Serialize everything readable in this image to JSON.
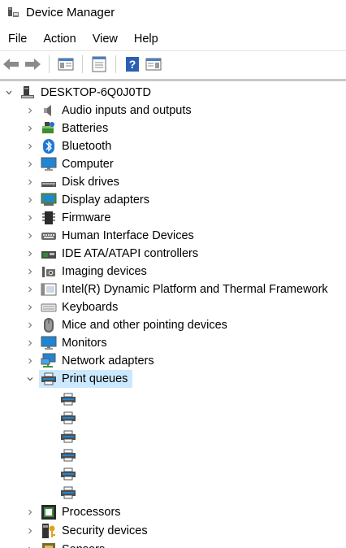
{
  "window": {
    "title": "Device Manager",
    "icon": "device-manager-icon"
  },
  "menu": [
    "File",
    "Action",
    "View",
    "Help"
  ],
  "toolbar": {
    "buttons": [
      {
        "name": "back-button",
        "icon": "arrow-left-icon"
      },
      {
        "name": "forward-button",
        "icon": "arrow-right-icon"
      },
      {
        "name": "show-hide-console-tree-button",
        "icon": "console-tree-icon"
      },
      {
        "name": "properties-button",
        "icon": "properties-icon"
      },
      {
        "name": "help-button",
        "icon": "help-icon"
      },
      {
        "name": "show-hide-action-pane-button",
        "icon": "action-pane-icon"
      }
    ]
  },
  "tree": {
    "root": {
      "label": "DESKTOP-6Q0J0TD",
      "icon": "computer-tower-icon",
      "expanded": true
    },
    "categories": [
      {
        "label": "Audio inputs and outputs",
        "icon": "speaker-icon"
      },
      {
        "label": "Batteries",
        "icon": "battery-icon"
      },
      {
        "label": "Bluetooth",
        "icon": "bluetooth-icon"
      },
      {
        "label": "Computer",
        "icon": "monitor-icon"
      },
      {
        "label": "Disk drives",
        "icon": "disk-drive-icon"
      },
      {
        "label": "Display adapters",
        "icon": "display-adapter-icon"
      },
      {
        "label": "Firmware",
        "icon": "firmware-icon"
      },
      {
        "label": "Human Interface Devices",
        "icon": "hid-icon"
      },
      {
        "label": "IDE ATA/ATAPI controllers",
        "icon": "ide-controller-icon"
      },
      {
        "label": "Imaging devices",
        "icon": "camera-icon"
      },
      {
        "label": "Intel(R) Dynamic Platform and Thermal Framework",
        "icon": "chip-icon"
      },
      {
        "label": "Keyboards",
        "icon": "keyboard-icon"
      },
      {
        "label": "Mice and other pointing devices",
        "icon": "mouse-icon"
      },
      {
        "label": "Monitors",
        "icon": "monitor-icon"
      },
      {
        "label": "Network adapters",
        "icon": "network-adapter-icon"
      },
      {
        "label": "Print queues",
        "icon": "printer-icon",
        "expanded": true,
        "selected": true,
        "children_count": 6
      },
      {
        "label": "Processors",
        "icon": "processor-icon"
      },
      {
        "label": "Security devices",
        "icon": "security-key-icon"
      },
      {
        "label": "Sensors",
        "icon": "sensor-icon"
      }
    ]
  },
  "colors": {
    "selection": "#cce8ff",
    "accent": "#0078d7"
  }
}
